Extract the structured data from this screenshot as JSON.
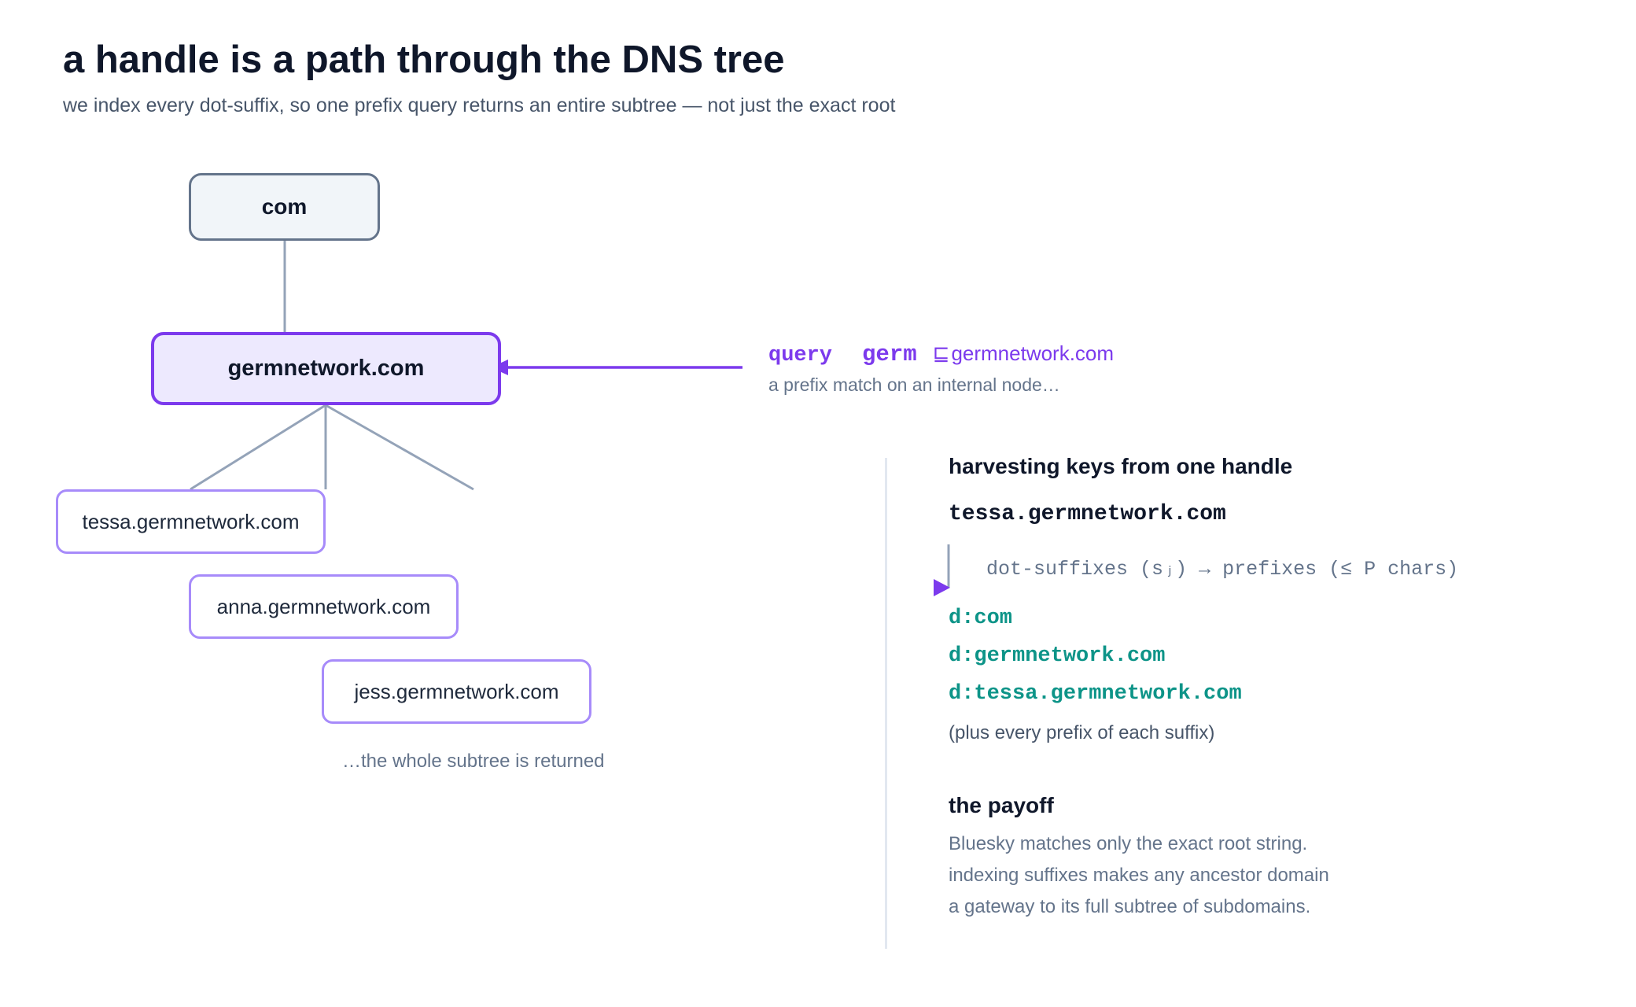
{
  "header": {
    "title": "a handle is a path through the DNS tree",
    "subtitle": "we index every dot-suffix, so one prefix query returns an entire subtree — not just the exact root"
  },
  "tree": {
    "root": "com",
    "internal": "germnetwork.com",
    "leaves": [
      "tessa.germnetwork.com",
      "anna.germnetwork.com",
      "jess.germnetwork.com"
    ],
    "subtree_note": "…the whole subtree is returned"
  },
  "query": {
    "keyword": "query",
    "term": "germ",
    "relation": "⊑",
    "target": "germnetwork.com",
    "note": "a prefix match on an internal node…"
  },
  "harvest": {
    "heading": "harvesting keys from one handle",
    "handle": "tessa.germnetwork.com",
    "caption": "dot-suffixes (sⱼ) → prefixes (≤ P chars)",
    "keys": [
      "d:com",
      "d:germnetwork.com",
      "d:tessa.germnetwork.com"
    ],
    "note": "(plus every prefix of each suffix)"
  },
  "payoff": {
    "heading": "the payoff",
    "lines": [
      "Bluesky matches only the exact root string.",
      "indexing suffixes makes any ancestor domain",
      "a gateway to its full subtree of subdomains."
    ]
  },
  "colors": {
    "accent": "#7c3aed",
    "accent_light": "#ede9fe",
    "leaf_border": "#a78bfa",
    "key_text": "#0d9488",
    "edge": "#94a3b8",
    "root_border": "#64748b"
  }
}
